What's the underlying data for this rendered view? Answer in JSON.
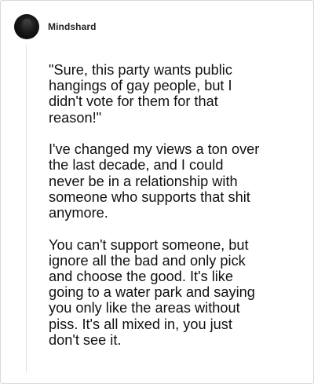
{
  "post": {
    "username": "Mindshard",
    "avatar_icon": "user-avatar-icon",
    "paragraphs": [
      {
        "lines": [
          "\"Sure, this party wants public",
          "hangings of gay people, but I",
          "didn't vote for them for that",
          "reason!\""
        ]
      },
      {
        "lines": [
          "I've changed my views a ton over",
          "the last decade, and I could",
          "never be in a relationship with",
          "someone who supports that shit",
          "anymore."
        ]
      },
      {
        "lines": [
          "You can't support someone, but",
          "ignore all the bad and only pick",
          "and choose the good. It's like",
          "going to a water park and saying",
          "you only like the areas without",
          "piss. It's all mixed in, you just",
          "don't see it."
        ]
      }
    ]
  }
}
